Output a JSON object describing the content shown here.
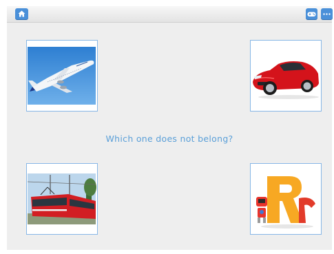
{
  "toolbar": {
    "home_icon": "home-icon",
    "game_icon": "gamepad-icon",
    "more_icon": "more-icon",
    "button_color": "#4a90d9"
  },
  "question": {
    "text": "Which one does not belong?",
    "color": "#5a9fd8"
  },
  "cards": [
    {
      "subject": "airplane"
    },
    {
      "subject": "red-car"
    },
    {
      "subject": "red-tram"
    },
    {
      "subject": "letter-r-robot",
      "letters": "Rr"
    }
  ]
}
